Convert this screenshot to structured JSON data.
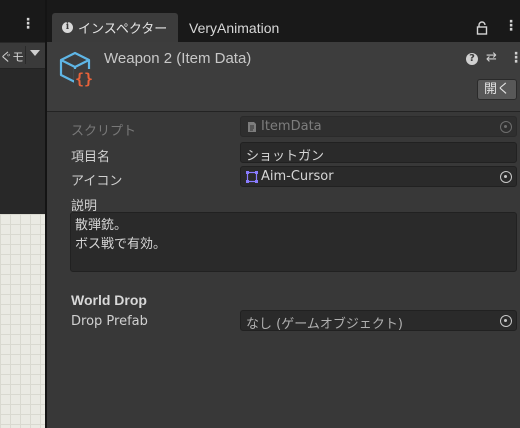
{
  "left_panel": {
    "toolbar_text": "ぐモ"
  },
  "tabs": [
    {
      "label": "インスペクター",
      "active": true
    },
    {
      "label": "VeryAnimation",
      "active": false
    }
  ],
  "header": {
    "title": "Weapon 2 (Item Data)",
    "open_button": "開く"
  },
  "fields": {
    "script": {
      "label": "スクリプト",
      "value": "ItemData"
    },
    "item_name": {
      "label": "項目名",
      "value": "ショットガン"
    },
    "icon": {
      "label": "アイコン",
      "value": "Aim-Cursor"
    },
    "description": {
      "label": "説明",
      "lines": [
        "散弾銃。",
        "ボス戦で有効。"
      ]
    }
  },
  "world_drop": {
    "title": "World Drop",
    "drop_prefab": {
      "label": "Drop Prefab",
      "value": "なし (ゲームオブジェクト)"
    }
  },
  "colors": {
    "cube_icon": "#5fb6e6",
    "braces": "#e8623a",
    "sprite_icon": "#8a7cff"
  }
}
